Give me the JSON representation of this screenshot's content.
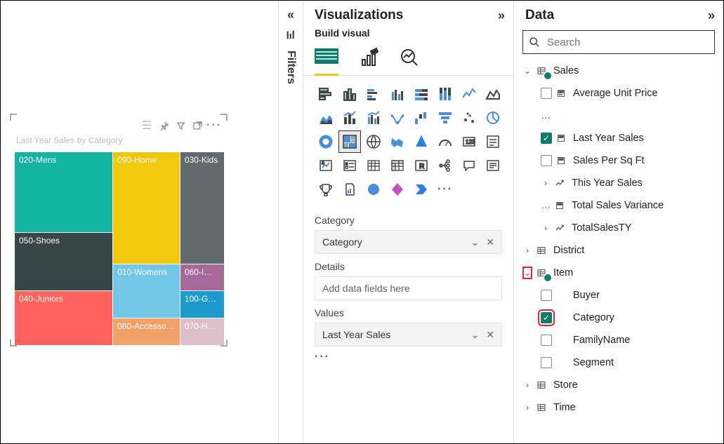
{
  "viz": {
    "pane_title": "Visualizations",
    "build_label": "Build visual",
    "sections": {
      "category": {
        "label": "Category",
        "value": "Category"
      },
      "details": {
        "label": "Details",
        "placeholder": "Add data fields here"
      },
      "values": {
        "label": "Values",
        "value": "Last Year Sales"
      }
    }
  },
  "data_pane": {
    "pane_title": "Data",
    "search_placeholder": "Search",
    "tables": {
      "sales": {
        "label": "Sales",
        "avg": "Average Unit Price",
        "lys": "Last Year Sales",
        "spsf": "Sales Per Sq Ft",
        "tys": "This Year Sales",
        "tsv": "Total Sales Variance",
        "tsty": "TotalSalesTY"
      },
      "district": {
        "label": "District"
      },
      "item": {
        "label": "Item",
        "buyer": "Buyer",
        "category": "Category",
        "family": "FamilyName",
        "segment": "Segment"
      },
      "store": {
        "label": "Store"
      },
      "time": {
        "label": "Time"
      }
    }
  },
  "filters": {
    "label": "Filters"
  },
  "chart_data": {
    "type": "treemap",
    "title": "Last Year Sales by Category",
    "categories": [
      {
        "key": "mens",
        "label": "020-Mens"
      },
      {
        "key": "home",
        "label": "090-Home"
      },
      {
        "key": "kids",
        "label": "030-Kids"
      },
      {
        "key": "shoes",
        "label": "050-Shoes"
      },
      {
        "key": "womens",
        "label": "010-Womens"
      },
      {
        "key": "juniors",
        "label": "040-Juniors"
      },
      {
        "key": "access",
        "label": "080-Accesso…"
      },
      {
        "key": "intim",
        "label": "060-I…"
      },
      {
        "key": "group",
        "label": "100-G…"
      },
      {
        "key": "hosiery",
        "label": "070-H…"
      }
    ]
  }
}
